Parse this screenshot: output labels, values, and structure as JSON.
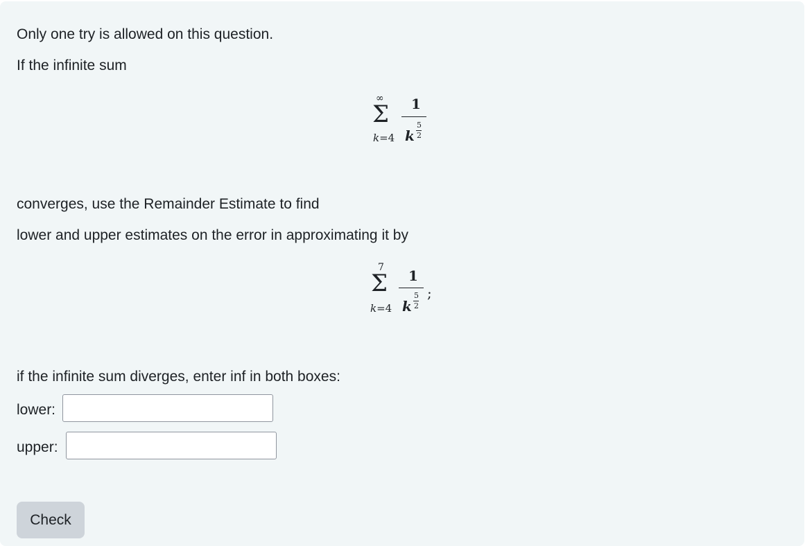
{
  "question": {
    "line1": "Only one try is allowed on this question.",
    "line2": "If the infinite sum",
    "line3": "converges, use the Remainder Estimate to find",
    "line4": "lower and upper estimates on the error in approximating it by",
    "line5": "if the infinite sum diverges, enter inf in both boxes:"
  },
  "sum1": {
    "sigma": "Σ",
    "upper": "∞",
    "lower_var": "k",
    "lower_rest": "=4",
    "numerator": "1",
    "base": "k",
    "exp_num": "5",
    "exp_den": "2"
  },
  "sum2": {
    "sigma": "Σ",
    "upper": "7",
    "lower_var": "k",
    "lower_rest": "=4",
    "numerator": "1",
    "base": "k",
    "exp_num": "5",
    "exp_den": "2",
    "trailing": ";"
  },
  "fields": {
    "lower_label": "lower:",
    "lower_value": "",
    "upper_label": "upper:",
    "upper_value": ""
  },
  "check_label": "Check"
}
